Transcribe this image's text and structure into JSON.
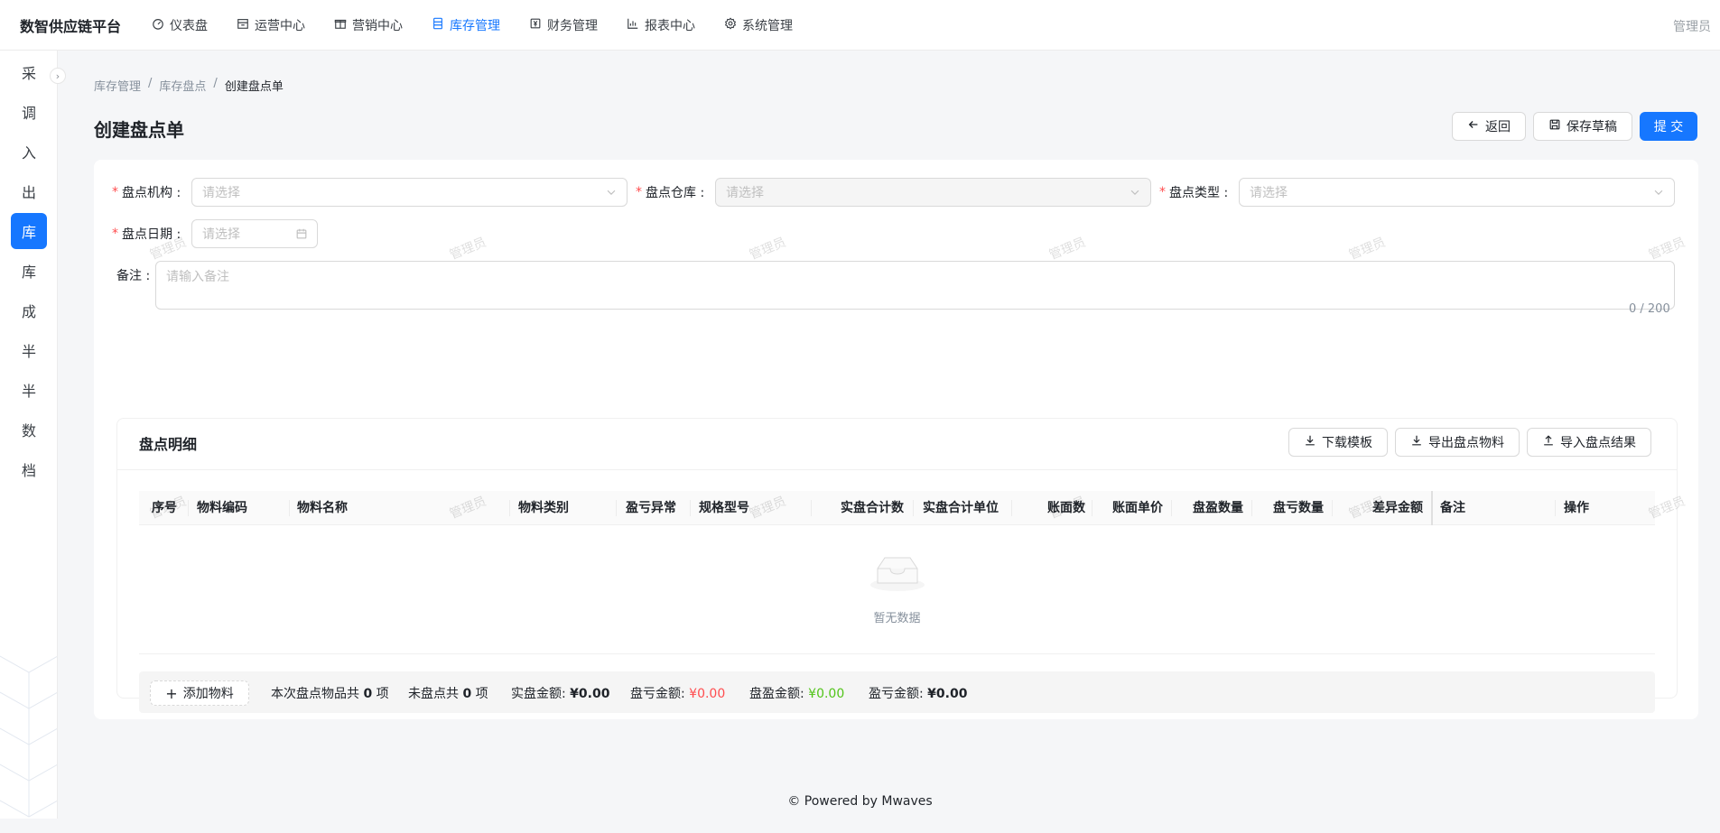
{
  "app": {
    "brand": "数智供应链平台",
    "user": "管理员"
  },
  "nav": [
    {
      "label": "仪表盘",
      "icon": "dashboard-icon"
    },
    {
      "label": "运营中心",
      "icon": "shop-icon"
    },
    {
      "label": "营销中心",
      "icon": "gift-icon"
    },
    {
      "label": "库存管理",
      "icon": "inventory-icon",
      "active": true
    },
    {
      "label": "财务管理",
      "icon": "finance-icon"
    },
    {
      "label": "报表中心",
      "icon": "chart-icon"
    },
    {
      "label": "系统管理",
      "icon": "gear-icon"
    }
  ],
  "sidebar": [
    "采",
    "调",
    "入",
    "出",
    "库",
    "库",
    "成",
    "半",
    "半",
    "数",
    "档"
  ],
  "sidebar_active_index": 4,
  "breadcrumb": [
    "库存管理",
    "库存盘点",
    "创建盘点单"
  ],
  "page": {
    "title": "创建盘点单"
  },
  "actions": {
    "back": "返回",
    "save_draft": "保存草稿",
    "submit": "提 交"
  },
  "form": {
    "org_label": "盘点机构 :",
    "warehouse_label": "盘点仓库 :",
    "type_label": "盘点类型 :",
    "date_label": "盘点日期 :",
    "remark_label": "备注 :",
    "select_placeholder": "请选择",
    "remark_placeholder": "请输入备注",
    "remark_count": "0 / 200"
  },
  "detail": {
    "title": "盘点明细",
    "download_template": "下载模板",
    "export_materials": "导出盘点物料",
    "import_results": "导入盘点结果",
    "columns": [
      "序号",
      "物料编码",
      "物料名称",
      "物料类别",
      "盈亏异常",
      "规格型号",
      "实盘合计数",
      "实盘合计单位",
      "账面数",
      "账面单价",
      "盘盈数量",
      "盘亏数量",
      "差异金额",
      "备注",
      "操作"
    ],
    "empty_text": "暂无数据",
    "add_material": "添加物料",
    "summary": {
      "total_prefix": "本次盘点物品共",
      "total_count": "0",
      "total_suffix": "项",
      "pending_prefix": "未盘点共",
      "pending_count": "0",
      "pending_suffix": "项",
      "actual_label": "实盘金额:",
      "actual_value": "¥0.00",
      "loss_label": "盘亏金额:",
      "loss_value": "¥0.00",
      "gain_label": "盘盈金额:",
      "gain_value": "¥0.00",
      "net_label": "盈亏金额:",
      "net_value": "¥0.00"
    }
  },
  "watermark": "管理员",
  "footer": {
    "powered": "Powered by Mwaves"
  },
  "colors": {
    "primary": "#1677ff",
    "danger": "#ff4d4f",
    "success": "#52c41a"
  }
}
